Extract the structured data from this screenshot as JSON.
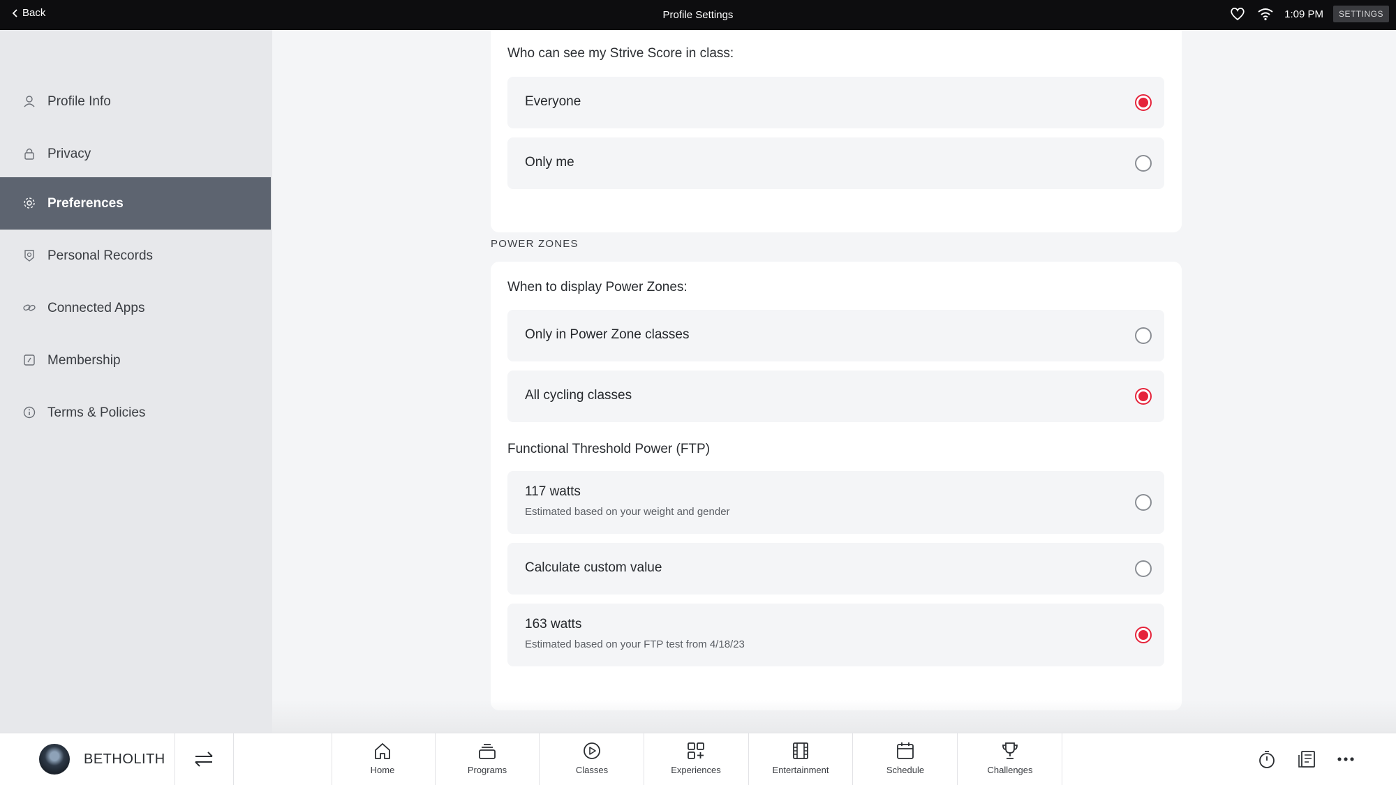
{
  "topbar": {
    "back_label": "Back",
    "title": "Profile Settings",
    "time": "1:09 PM",
    "settings_label": "SETTINGS"
  },
  "sidebar": {
    "items": [
      {
        "label": "Profile Info",
        "icon": "person-icon"
      },
      {
        "label": "Privacy",
        "icon": "lock-icon"
      },
      {
        "label": "Preferences",
        "icon": "gear-icon",
        "active": true
      },
      {
        "label": "Personal Records",
        "icon": "badge-icon"
      },
      {
        "label": "Connected Apps",
        "icon": "link-icon"
      },
      {
        "label": "Membership",
        "icon": "membership-icon"
      },
      {
        "label": "Terms & Policies",
        "icon": "info-icon"
      }
    ]
  },
  "main": {
    "strive": {
      "question": "Who can see my Strive Score in class:",
      "options": [
        {
          "label": "Everyone",
          "selected": true
        },
        {
          "label": "Only me",
          "selected": false
        }
      ]
    },
    "power_zones": {
      "section_title": "POWER ZONES",
      "question": "When to display Power Zones:",
      "options": [
        {
          "label": "Only in Power Zone classes",
          "selected": false
        },
        {
          "label": "All cycling classes",
          "selected": true
        }
      ],
      "ftp_label": "Functional Threshold Power (FTP)",
      "ftp_options": [
        {
          "label": "117 watts",
          "sub": "Estimated based on your weight and gender",
          "selected": false
        },
        {
          "label": "Calculate custom value",
          "selected": false
        },
        {
          "label": "163 watts",
          "sub": "Estimated based on your FTP test from 4/18/23",
          "selected": true
        }
      ]
    }
  },
  "bottombar": {
    "username": "BETHOLITH",
    "nav": [
      {
        "label": "Home",
        "icon": "home-icon"
      },
      {
        "label": "Programs",
        "icon": "programs-icon"
      },
      {
        "label": "Classes",
        "icon": "play-icon"
      },
      {
        "label": "Experiences",
        "icon": "grid-plus-icon"
      },
      {
        "label": "Entertainment",
        "icon": "film-icon"
      },
      {
        "label": "Schedule",
        "icon": "calendar-icon"
      },
      {
        "label": "Challenges",
        "icon": "trophy-icon"
      }
    ]
  },
  "colors": {
    "accent": "#e5243b",
    "sidebar_active": "#5d6470",
    "topbar": "#0d0d0f"
  }
}
